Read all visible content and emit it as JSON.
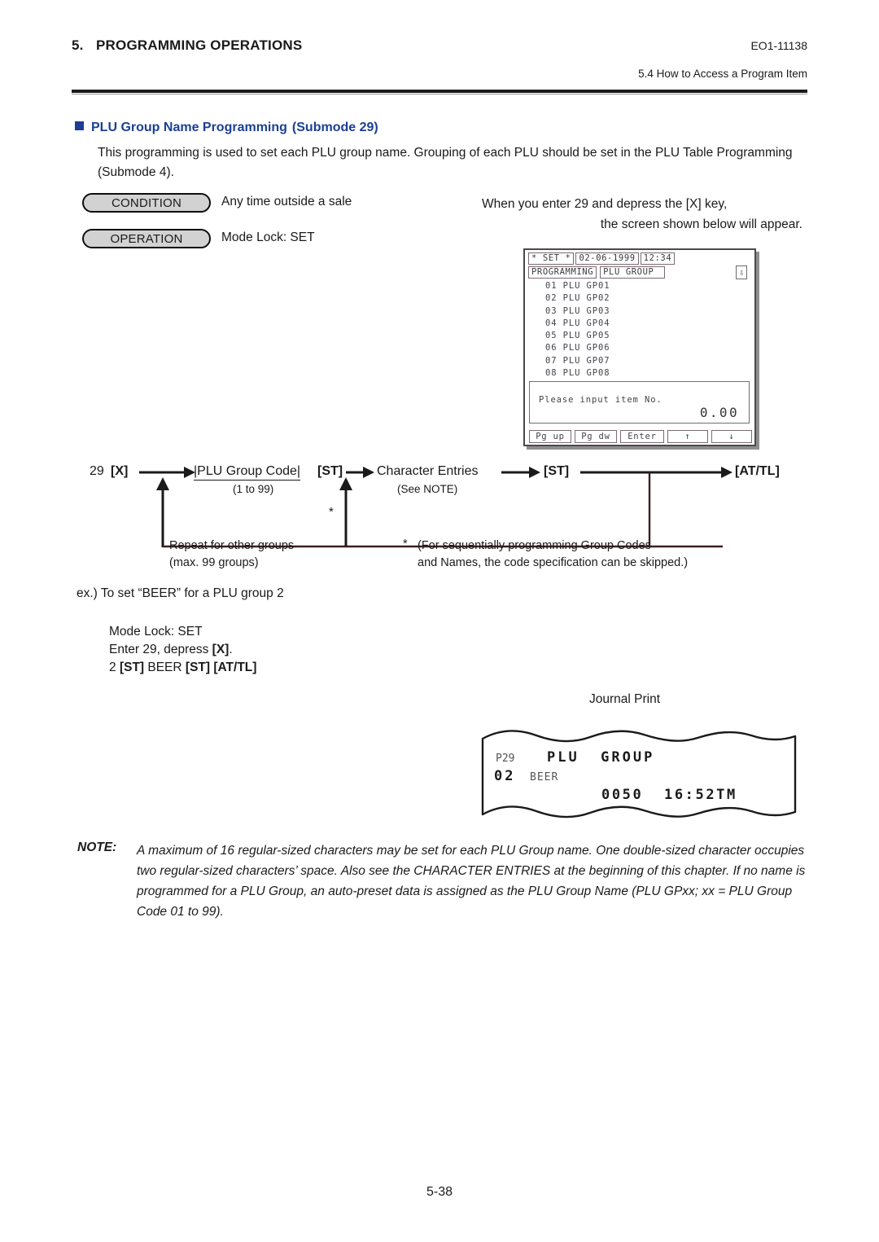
{
  "header": {
    "chapter_number": "5.",
    "chapter_title": "PROGRAMMING OPERATIONS",
    "doc_code": "EO1-11138",
    "section_ref": "5.4  How to Access a Program Item"
  },
  "section": {
    "heading": "PLU Group Name Programming",
    "heading_submode": "(Submode 29)",
    "intro": "This programming is used to set each PLU group name. Grouping of each PLU should be set in the PLU Table Programming (Submode 4)."
  },
  "condition_block": {
    "condition_label": "CONDITION",
    "condition_value": "Any time outside a sale",
    "operation_label": "OPERATION",
    "operation_value": "Mode Lock:  SET"
  },
  "screen_caption": {
    "line1": "When you enter 29 and depress the [X] key,",
    "line2": "the screen shown below will appear."
  },
  "lcd": {
    "mode": "* SET *",
    "date": "02-06-1999",
    "time": "12:34",
    "title_left": "PROGRAMMING",
    "title_right": "PLU GROUP",
    "scroll_indicator": "⇩",
    "rows": [
      "01 PLU GP01",
      "02 PLU GP02",
      "03 PLU GP03",
      "04 PLU GP04",
      "05 PLU GP05",
      "06 PLU GP06",
      "07 PLU GP07",
      "08 PLU GP08"
    ],
    "message": "Please input item No.",
    "amount": "0.00",
    "softkeys": [
      "Pg up",
      "Pg dw",
      "Enter",
      "↑",
      "↓"
    ]
  },
  "flow": {
    "start_number": "29",
    "start_key": "[X]",
    "code_label": "|PLU Group Code|",
    "code_range": "(1 to 99)",
    "key_st_1": "[ST]",
    "char_entries": "Character Entries",
    "char_note": "(See NOTE)",
    "key_st_2": "[ST]",
    "key_attl": "[AT/TL]",
    "star": "*",
    "note_left_line1": "Repeat for other groups",
    "note_left_line2": "(max. 99 groups)",
    "note_right_star": "*",
    "note_right_line1": "(For sequentially programming Group Codes",
    "note_right_line2": "and Names, the code specification can be skipped.)"
  },
  "example": {
    "title": "ex.)  To set “BEER” for a PLU group 2",
    "line1": "Mode Lock:  SET",
    "line2_prefix": "Enter 29, depress ",
    "line2_key": "[X]",
    "line2_suffix": ".",
    "line3_num": "2 ",
    "line3_st1": "[ST]",
    "line3_word": "  BEER ",
    "line3_st2": "[ST]",
    "line3_attl": "  [AT/TL]"
  },
  "journal": {
    "label": "Journal Print",
    "line1_code": "P29",
    "line1_title": "PLU  GROUP",
    "line2_code": "02",
    "line2_name": "BEER",
    "line3": "0050  16:52TM"
  },
  "note": {
    "label": "NOTE:",
    "body": "A maximum of 16 regular-sized characters may be set for each PLU Group name.  One double-sized character occupies two regular-sized characters’ space.  Also see the CHARACTER ENTRIES at the beginning of this chapter. If no name is programmed for a PLU Group, an auto-preset data is assigned as the PLU Group Name (PLU GPxx;  xx = PLU Group Code 01 to 99)."
  },
  "footer": {
    "page_number": "5-38"
  },
  "colors": {
    "heading_blue": "#1c3f94",
    "rule_black": "#1a1a1a",
    "pill_fill": "#d2d2d2",
    "lcd_text": "#46414a"
  }
}
